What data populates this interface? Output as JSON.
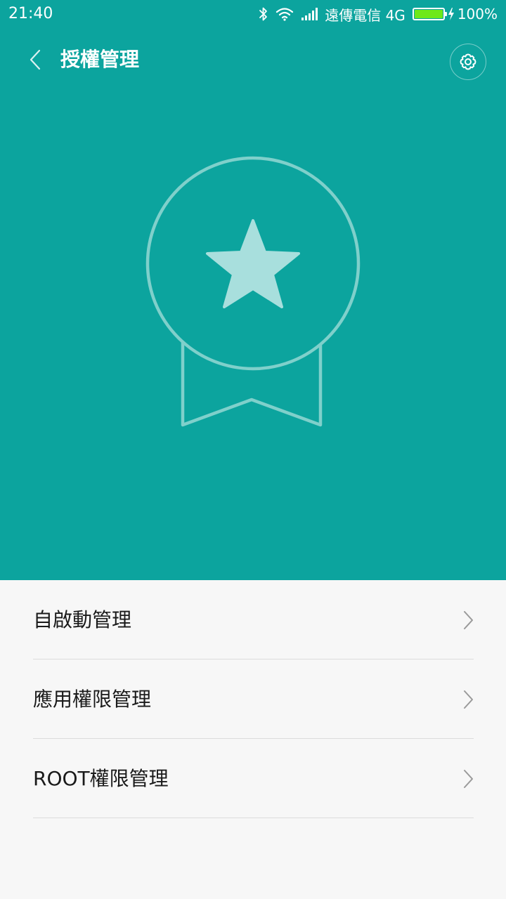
{
  "status_bar": {
    "time": "21:40",
    "carrier": "遠傳電信 4G",
    "battery_percent": "100%",
    "battery_level": 1.0,
    "icons": [
      "bluetooth-icon",
      "wifi-icon",
      "signal-icon",
      "battery-icon",
      "charging-icon"
    ]
  },
  "header": {
    "title": "授權管理",
    "back_icon": "chevron-left-icon",
    "settings_icon": "gear-icon"
  },
  "hero": {
    "illustration": "award-badge-star-icon"
  },
  "menu": {
    "items": [
      {
        "label": "自啟動管理"
      },
      {
        "label": "應用權限管理"
      },
      {
        "label": "ROOT權限管理"
      }
    ]
  },
  "colors": {
    "accent": "#0ca49e",
    "badge_line": "#7fd0cb",
    "star_fill": "#a8dfdd",
    "battery_fill": "#6ee81a",
    "list_background": "#f7f7f7",
    "divider": "#dcdcdc",
    "chevron": "#9a9a9a"
  }
}
